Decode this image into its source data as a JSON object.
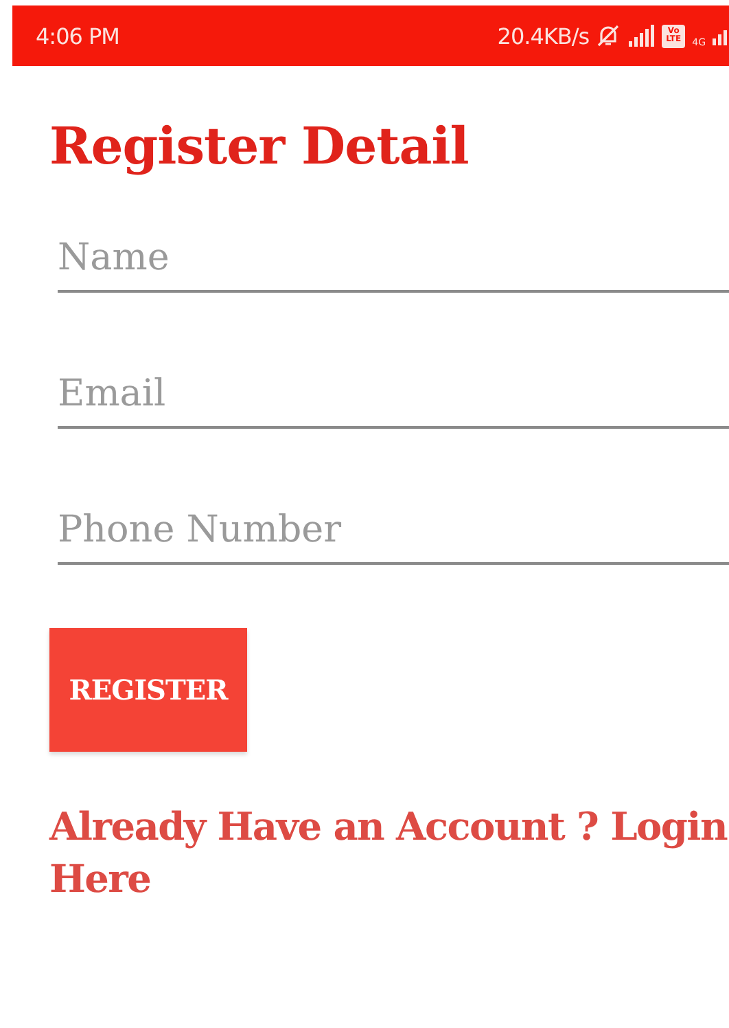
{
  "status_bar": {
    "time": "4:06 PM",
    "speed": "20.4KB/s",
    "volte": [
      "Vo",
      "LTE"
    ],
    "network": "4G"
  },
  "title": "Register Detail",
  "fields": [
    {
      "placeholder": "Name"
    },
    {
      "placeholder": "Email"
    },
    {
      "placeholder": "Phone Number"
    }
  ],
  "button": "REGISTER",
  "login_link": "Already Have an Account ? Login Here"
}
